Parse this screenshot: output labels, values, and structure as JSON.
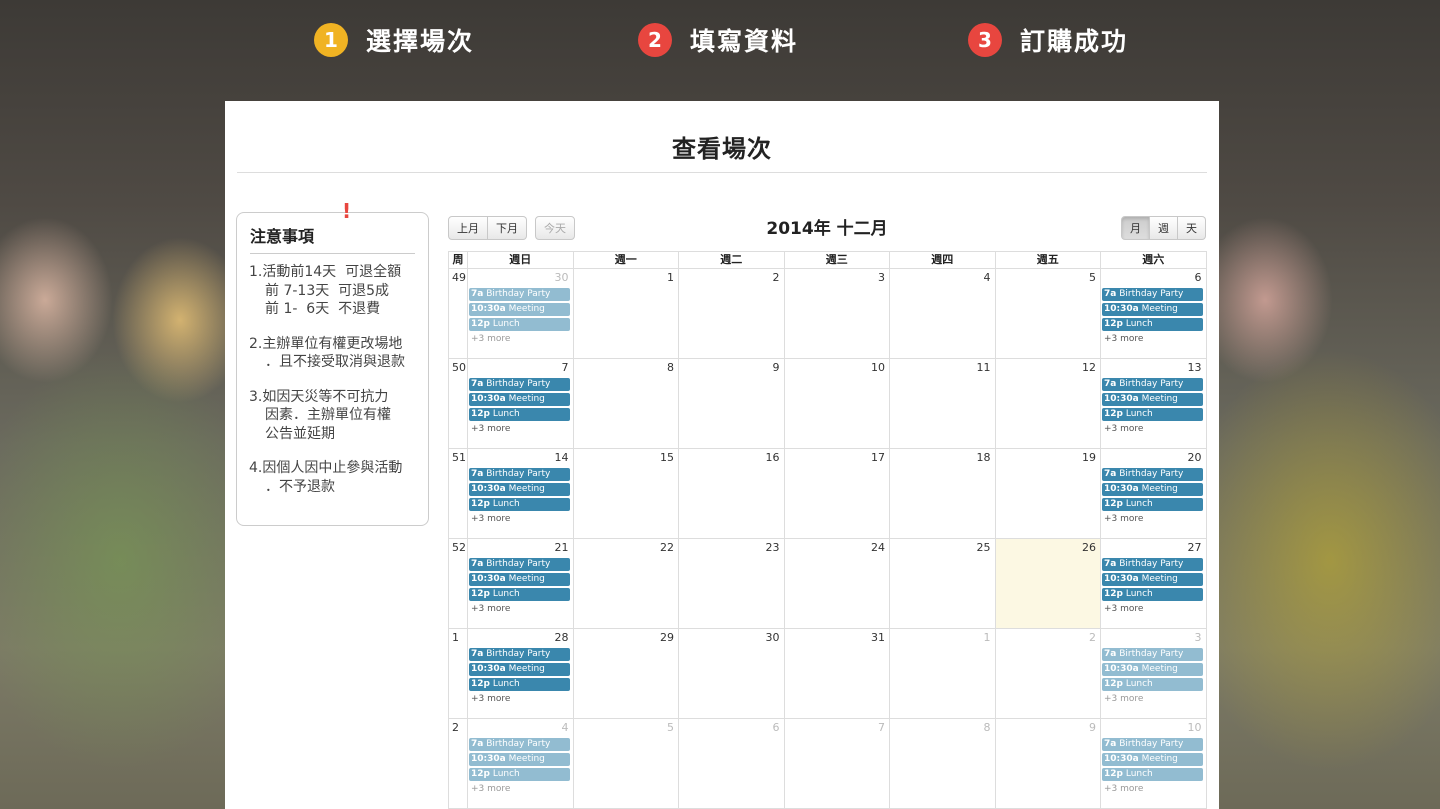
{
  "steps": [
    {
      "num": "1",
      "label": "選擇場次"
    },
    {
      "num": "2",
      "label": "填寫資料"
    },
    {
      "num": "3",
      "label": "訂購成功"
    }
  ],
  "panel": {
    "title": "查看場次"
  },
  "notice": {
    "bang": "!",
    "title": "注意事項",
    "items": [
      [
        "1.活動前14天  可退全額",
        "前 7-13天  可退5成",
        "前 1-  6天  不退費"
      ],
      [
        "2.主辦單位有權更改場地",
        "．且不接受取消與退款"
      ],
      [
        "3.如因天災等不可抗力",
        "因素．主辦單位有權",
        "公告並延期"
      ],
      [
        "4.因個人因中止參與活動",
        "．不予退款"
      ]
    ]
  },
  "calendar": {
    "prev_label": "上月",
    "next_label": "下月",
    "today_label": "今天",
    "title": "2014年 十二月",
    "views": [
      "月",
      "週",
      "天"
    ],
    "headers": [
      "周",
      "週日",
      "週一",
      "週二",
      "週三",
      "週四",
      "週五",
      "週六"
    ],
    "event_labels": [
      {
        "time": "7a",
        "title": "Birthday Party"
      },
      {
        "time": "10:30a",
        "title": "Meeting"
      },
      {
        "time": "12p",
        "title": "Lunch"
      }
    ],
    "more_label": "+3 more",
    "weeks": [
      {
        "week": "49",
        "days": [
          {
            "d": "30",
            "other": true,
            "events": true,
            "faded": true
          },
          {
            "d": "1"
          },
          {
            "d": "2"
          },
          {
            "d": "3"
          },
          {
            "d": "4"
          },
          {
            "d": "5"
          },
          {
            "d": "6",
            "events": true
          }
        ]
      },
      {
        "week": "50",
        "days": [
          {
            "d": "7",
            "events": true
          },
          {
            "d": "8"
          },
          {
            "d": "9"
          },
          {
            "d": "10"
          },
          {
            "d": "11"
          },
          {
            "d": "12"
          },
          {
            "d": "13",
            "events": true
          }
        ]
      },
      {
        "week": "51",
        "days": [
          {
            "d": "14",
            "events": true
          },
          {
            "d": "15"
          },
          {
            "d": "16"
          },
          {
            "d": "17"
          },
          {
            "d": "18"
          },
          {
            "d": "19"
          },
          {
            "d": "20",
            "events": true
          }
        ]
      },
      {
        "week": "52",
        "days": [
          {
            "d": "21",
            "events": true
          },
          {
            "d": "22"
          },
          {
            "d": "23"
          },
          {
            "d": "24"
          },
          {
            "d": "25"
          },
          {
            "d": "26",
            "today": true
          },
          {
            "d": "27",
            "events": true
          }
        ]
      },
      {
        "week": "1",
        "days": [
          {
            "d": "28",
            "events": true
          },
          {
            "d": "29"
          },
          {
            "d": "30"
          },
          {
            "d": "31"
          },
          {
            "d": "1",
            "other": true
          },
          {
            "d": "2",
            "other": true
          },
          {
            "d": "3",
            "other": true,
            "events": true,
            "faded": true
          }
        ]
      },
      {
        "week": "2",
        "days": [
          {
            "d": "4",
            "other": true,
            "events": true,
            "faded": true
          },
          {
            "d": "5",
            "other": true
          },
          {
            "d": "6",
            "other": true
          },
          {
            "d": "7",
            "other": true
          },
          {
            "d": "8",
            "other": true
          },
          {
            "d": "9",
            "other": true
          },
          {
            "d": "10",
            "other": true,
            "events": true,
            "faded": true
          }
        ]
      }
    ]
  }
}
